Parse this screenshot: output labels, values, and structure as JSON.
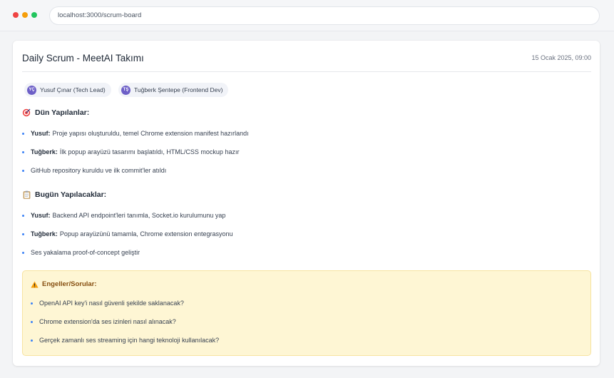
{
  "browser": {
    "url": "localhost:3000/scrum-board"
  },
  "card": {
    "title": "Daily Scrum - MeetAI Takımı",
    "timestamp": "15 Ocak 2025, 09:00"
  },
  "participants": [
    {
      "initials": "YÇ",
      "label": "Yusuf Çınar (Tech Lead)"
    },
    {
      "initials": "TŞ",
      "label": "Tuğberk Şentepe (Frontend Dev)"
    }
  ],
  "yesterday": {
    "icon": "target-icon",
    "title": "Dün Yapılanlar:",
    "items": [
      {
        "name": "Yusuf:",
        "text": "Proje yapısı oluşturuldu, temel Chrome extension manifest hazırlandı"
      },
      {
        "name": "Tuğberk:",
        "text": "İlk popup arayüzü tasarımı başlatıldı, HTML/CSS mockup hazır"
      },
      {
        "name": "",
        "text": "GitHub repository kuruldu ve ilk commit'ler atıldı"
      }
    ]
  },
  "today": {
    "icon": "clipboard-icon",
    "title": "Bugün Yapılacaklar:",
    "items": [
      {
        "name": "Yusuf:",
        "text": "Backend API endpoint'leri tanımla, Socket.io kurulumunu yap"
      },
      {
        "name": "Tuğberk:",
        "text": "Popup arayüzünü tamamla, Chrome extension entegrasyonu"
      },
      {
        "name": "",
        "text": "Ses yakalama proof-of-concept geliştir"
      }
    ]
  },
  "blockers": {
    "icon": "warning-icon",
    "title": "Engeller/Sorular:",
    "items": [
      "OpenAI API key'i nasıl güvenli şekilde saklanacak?",
      "Chrome extension'da ses izinleri nasıl alınacak?",
      "Gerçek zamanlı ses streaming için hangi teknoloji kullanılacak?"
    ]
  },
  "colors": {
    "accent": "#3b82f6",
    "avatar": "#6d5fc7",
    "blocker_bg": "#fef6d4",
    "blocker_title": "#854d0e"
  }
}
